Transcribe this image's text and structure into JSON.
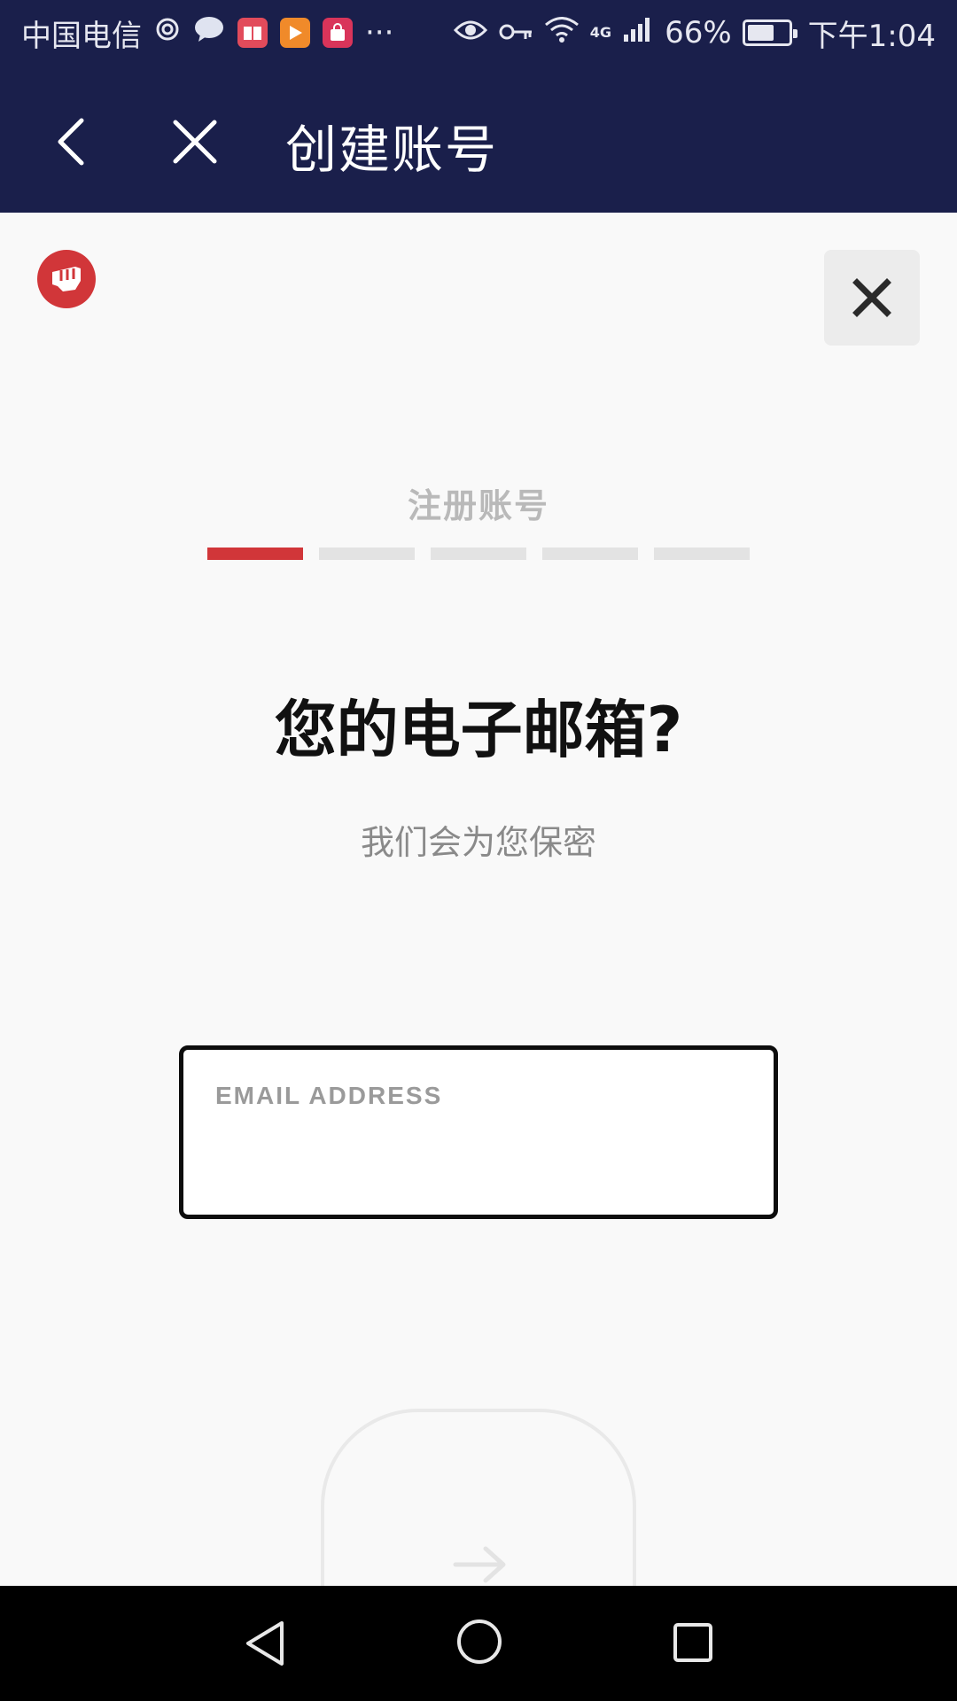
{
  "status_bar": {
    "carrier": "中国电信",
    "more_indicator": "···",
    "network_type": "4G",
    "battery": "66%",
    "battery_level": 0.66,
    "time": "下午1:04",
    "app_icons": [
      "eye-comfort-icon",
      "chat-bubble-icon",
      "book-app-icon",
      "video-app-icon",
      "shopping-app-icon"
    ]
  },
  "nav_bar": {
    "title": "创建账号"
  },
  "signup": {
    "step_title": "注册账号",
    "progress": {
      "current_step": 1,
      "total_steps": 5
    },
    "question": "您的电子邮箱?",
    "subtitle": "我们会为您保密",
    "email": {
      "label": "EMAIL ADDRESS",
      "value": ""
    }
  },
  "colors": {
    "header_bg": "#1a1f4b",
    "accent": "#d13639",
    "page_bg": "#f9f9f9",
    "system_nav_bg": "#000000"
  }
}
